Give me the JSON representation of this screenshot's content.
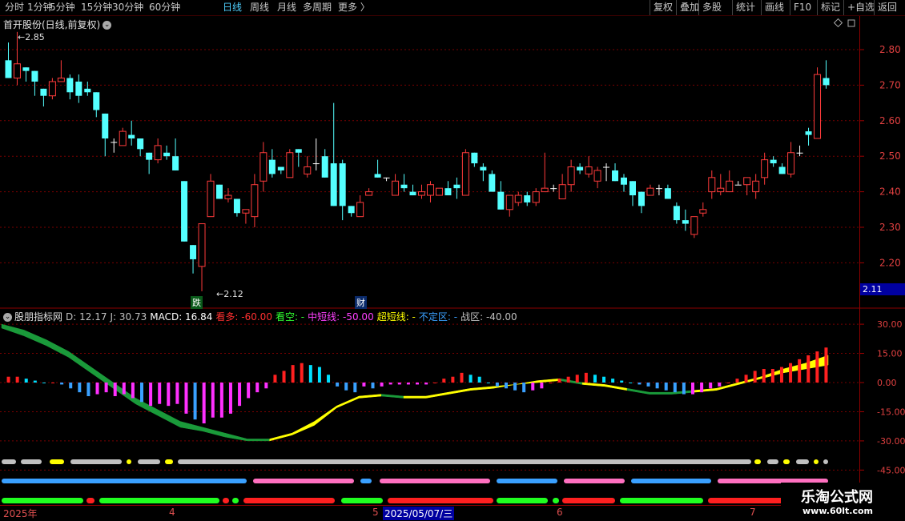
{
  "toolbar": {
    "periods": [
      "分时",
      "1分钟",
      "5分钟",
      "15分钟",
      "30分钟",
      "60分钟",
      "日线",
      "周线",
      "月线",
      "多周期",
      "更多 〉"
    ],
    "active_period": "日线",
    "right_items": [
      "复权",
      "叠加",
      "多股",
      "统计",
      "画线",
      "F10",
      "标记",
      "+自选",
      "返回"
    ]
  },
  "stock": {
    "title": "首开股份(日线,前复权)",
    "high_label": "2.85",
    "low_label": "2.12",
    "current_price": "2.11",
    "markers": [
      "跌",
      "财"
    ]
  },
  "price_axis": {
    "labels": [
      "2.80",
      "2.70",
      "2.60",
      "2.50",
      "2.40",
      "2.30",
      "2.20"
    ]
  },
  "indicator": {
    "name": "股朋指标网",
    "items": [
      {
        "label": "D: 12.17",
        "color": "#c0c0c0"
      },
      {
        "label": "J: 30.73",
        "color": "#c0c0c0"
      },
      {
        "label": "MACD: 16.84",
        "color": "#ffffff"
      },
      {
        "label": "看多: -60.00",
        "color": "#ff3030"
      },
      {
        "label": "看空: -",
        "color": "#30ff30"
      },
      {
        "label": "中短线: -50.00",
        "color": "#ff40ff"
      },
      {
        "label": "超短线: -",
        "color": "#ffff00"
      },
      {
        "label": "不定区: -",
        "color": "#3aa0ff"
      },
      {
        "label": "战区: -40.00",
        "color": "#c0c0c0"
      }
    ],
    "axis_labels": [
      "30.00",
      "15.00",
      "0.00",
      "-15.00",
      "-30.00",
      "-45.00"
    ]
  },
  "dates": {
    "items": [
      "2025年",
      "4",
      "5",
      "2025/05/07/三",
      "6",
      "7"
    ]
  },
  "watermark": {
    "line1": "乐淘公式网",
    "line2": "www.60lt.com"
  },
  "colors": {
    "up": "#ff3b3b",
    "down": "#54ffff",
    "grid": "#8b0000"
  },
  "chart_data": {
    "type": "candlestick",
    "price_range": [
      2.11,
      2.86
    ],
    "candles": [
      [
        2.77,
        2.72,
        2.82,
        2.72
      ],
      [
        2.72,
        2.76,
        2.85,
        2.7
      ],
      [
        2.75,
        2.74,
        2.75,
        2.71
      ],
      [
        2.74,
        2.71,
        2.74,
        2.67
      ],
      [
        2.69,
        2.67,
        2.69,
        2.64
      ],
      [
        2.67,
        2.71,
        2.72,
        2.66
      ],
      [
        2.71,
        2.72,
        2.77,
        2.71
      ],
      [
        2.72,
        2.68,
        2.73,
        2.66
      ],
      [
        2.71,
        2.67,
        2.73,
        2.65
      ],
      [
        2.69,
        2.68,
        2.71,
        2.67
      ],
      [
        2.68,
        2.63,
        2.68,
        2.61
      ],
      [
        2.62,
        2.55,
        2.62,
        2.5
      ],
      [
        2.54,
        2.54,
        2.55,
        2.51
      ],
      [
        2.53,
        2.57,
        2.58,
        2.53
      ],
      [
        2.56,
        2.55,
        2.6,
        2.53
      ],
      [
        2.55,
        2.52,
        2.55,
        2.5
      ],
      [
        2.51,
        2.49,
        2.51,
        2.45
      ],
      [
        2.49,
        2.53,
        2.55,
        2.48
      ],
      [
        2.51,
        2.5,
        2.53,
        2.49
      ],
      [
        2.5,
        2.46,
        2.55,
        2.46
      ],
      [
        2.43,
        2.26,
        2.43,
        2.26
      ],
      [
        2.25,
        2.21,
        2.25,
        2.17
      ],
      [
        2.19,
        2.31,
        2.31,
        2.12
      ],
      [
        2.33,
        2.43,
        2.45,
        2.33
      ],
      [
        2.42,
        2.38,
        2.42,
        2.38
      ],
      [
        2.38,
        2.39,
        2.41,
        2.37
      ],
      [
        2.38,
        2.34,
        2.38,
        2.33
      ],
      [
        2.34,
        2.35,
        2.35,
        2.31
      ],
      [
        2.33,
        2.42,
        2.45,
        2.3
      ],
      [
        2.43,
        2.51,
        2.54,
        2.4
      ],
      [
        2.49,
        2.45,
        2.52,
        2.44
      ],
      [
        2.47,
        2.46,
        2.47,
        2.45
      ],
      [
        2.44,
        2.51,
        2.52,
        2.44
      ],
      [
        2.52,
        2.51,
        2.52,
        2.47
      ],
      [
        2.45,
        2.47,
        2.5,
        2.44
      ],
      [
        2.48,
        2.48,
        2.55,
        2.46
      ],
      [
        2.5,
        2.44,
        2.52,
        2.44
      ],
      [
        2.48,
        2.36,
        2.65,
        2.36
      ],
      [
        2.48,
        2.36,
        2.49,
        2.32
      ],
      [
        2.36,
        2.34,
        2.36,
        2.33
      ],
      [
        2.33,
        2.37,
        2.39,
        2.34
      ],
      [
        2.39,
        2.4,
        2.41,
        2.4
      ],
      [
        2.45,
        2.44,
        2.49,
        2.44
      ],
      [
        2.44,
        2.44,
        2.44,
        2.43
      ],
      [
        2.39,
        2.43,
        2.45,
        2.39
      ],
      [
        2.42,
        2.41,
        2.45,
        2.4
      ],
      [
        2.4,
        2.39,
        2.42,
        2.39
      ],
      [
        2.39,
        2.4,
        2.42,
        2.38
      ],
      [
        2.39,
        2.42,
        2.43,
        2.37
      ],
      [
        2.39,
        2.41,
        2.41,
        2.39
      ],
      [
        2.41,
        2.39,
        2.43,
        2.39
      ],
      [
        2.42,
        2.41,
        2.44,
        2.38
      ],
      [
        2.39,
        2.51,
        2.52,
        2.4
      ],
      [
        2.51,
        2.48,
        2.51,
        2.47
      ],
      [
        2.47,
        2.46,
        2.48,
        2.43
      ],
      [
        2.45,
        2.4,
        2.46,
        2.4
      ],
      [
        2.4,
        2.35,
        2.43,
        2.35
      ],
      [
        2.35,
        2.39,
        2.39,
        2.33
      ],
      [
        2.37,
        2.39,
        2.4,
        2.36
      ],
      [
        2.39,
        2.37,
        2.4,
        2.36
      ],
      [
        2.37,
        2.4,
        2.41,
        2.36
      ],
      [
        2.4,
        2.41,
        2.51,
        2.4
      ],
      [
        2.41,
        2.41,
        2.42,
        2.4
      ],
      [
        2.38,
        2.42,
        2.45,
        2.38
      ],
      [
        2.42,
        2.47,
        2.49,
        2.4
      ],
      [
        2.47,
        2.46,
        2.48,
        2.45
      ],
      [
        2.45,
        2.47,
        2.5,
        2.44
      ],
      [
        2.43,
        2.46,
        2.47,
        2.41
      ],
      [
        2.47,
        2.47,
        2.48,
        2.43
      ],
      [
        2.46,
        2.43,
        2.48,
        2.43
      ],
      [
        2.44,
        2.42,
        2.45,
        2.4
      ],
      [
        2.43,
        2.39,
        2.43,
        2.36
      ],
      [
        2.4,
        2.36,
        2.4,
        2.34
      ],
      [
        2.39,
        2.41,
        2.42,
        2.39
      ],
      [
        2.41,
        2.41,
        2.42,
        2.39
      ],
      [
        2.41,
        2.38,
        2.42,
        2.38
      ],
      [
        2.36,
        2.32,
        2.37,
        2.31
      ],
      [
        2.32,
        2.31,
        2.35,
        2.29
      ],
      [
        2.28,
        2.33,
        2.33,
        2.27
      ],
      [
        2.34,
        2.35,
        2.37,
        2.33
      ],
      [
        2.4,
        2.44,
        2.46,
        2.38
      ],
      [
        2.4,
        2.41,
        2.45,
        2.39
      ],
      [
        2.4,
        2.43,
        2.46,
        2.4
      ],
      [
        2.42,
        2.42,
        2.43,
        2.42
      ],
      [
        2.42,
        2.44,
        2.44,
        2.39
      ],
      [
        2.4,
        2.43,
        2.45,
        2.38
      ],
      [
        2.44,
        2.49,
        2.51,
        2.42
      ],
      [
        2.49,
        2.48,
        2.5,
        2.47
      ],
      [
        2.47,
        2.45,
        2.48,
        2.45
      ],
      [
        2.45,
        2.51,
        2.54,
        2.44
      ],
      [
        2.51,
        2.51,
        2.53,
        2.5
      ],
      [
        2.57,
        2.56,
        2.58,
        2.53
      ],
      [
        2.55,
        2.73,
        2.75,
        2.55
      ],
      [
        2.72,
        2.7,
        2.77,
        2.69
      ]
    ],
    "macd": [
      3,
      3,
      2,
      1,
      0,
      0,
      -1,
      -3,
      -5,
      -7,
      -6,
      -5,
      -7,
      -6,
      -8,
      -10,
      -12,
      -11,
      -12,
      -11,
      -16,
      -19,
      -21,
      -18,
      -18,
      -16,
      -12,
      -8,
      -5,
      -3,
      4,
      6,
      9,
      10,
      9,
      8,
      4,
      -2,
      -4,
      -5,
      -2,
      -3,
      -2,
      -1,
      -1,
      -1,
      -1,
      -1,
      0,
      2,
      3,
      5,
      4,
      3,
      0,
      -2,
      -3,
      -4,
      -5,
      -4,
      -3,
      0,
      2,
      3,
      4,
      5,
      4,
      3,
      2,
      1,
      0,
      -1,
      -2,
      -3,
      -4,
      -5,
      -6,
      -6,
      -5,
      -3,
      -2,
      0,
      2,
      4,
      6,
      7,
      7,
      8,
      10,
      12,
      14,
      16,
      18
    ],
    "ribbon_upper": [
      30,
      27,
      22,
      16,
      8,
      0,
      -8,
      -14,
      -20,
      -23,
      -26,
      -29,
      -29,
      -26,
      -20,
      -12,
      -7,
      -6,
      -7,
      -7,
      -5,
      -3,
      -2,
      -1,
      1,
      2,
      0,
      -1,
      -3,
      -5,
      -5,
      -4,
      -3,
      0,
      3,
      7,
      10,
      14
    ],
    "ribbon_lower": [
      28,
      24,
      19,
      13,
      5,
      -3,
      -11,
      -17,
      -23,
      -25,
      -28,
      -30,
      -30,
      -27,
      -22,
      -13,
      -8,
      -7,
      -8,
      -8,
      -6,
      -4,
      -3,
      -1,
      0,
      1,
      -1,
      -2,
      -4,
      -6,
      -6,
      -5,
      -4,
      -1,
      2,
      5,
      7,
      9
    ],
    "ribbon_colors": [
      "#1a9a3a",
      "#1a9a3a",
      "#1a9a3a",
      "#1a9a3a",
      "#1a9a3a",
      "#1a9a3a",
      "#1a9a3a",
      "#1a9a3a",
      "#1a9a3a",
      "#1a9a3a",
      "#1a9a3a",
      "#1a9a3a",
      "#ffff00",
      "#ffff00",
      "#ffff00",
      "#ffff00",
      "#ffff00",
      "#1a9a3a",
      "#ffff00",
      "#ffff00",
      "#ffff00",
      "#ffff00",
      "#ffff00",
      "#ffff00",
      "#ffff00",
      "#1a9a3a",
      "#ffff00",
      "#ffff00",
      "#1a9a3a",
      "#1a9a3a",
      "#1a9a3a",
      "#ffff00",
      "#ffff00",
      "#ffff00",
      "#ffff00",
      "#ffff00",
      "#ffff00",
      "#ff3030"
    ],
    "bar_gray": [
      [
        2,
        20,
        "#c0c0c0"
      ],
      [
        26,
        52,
        "#c0c0c0"
      ],
      [
        62,
        80,
        "#ffff00"
      ],
      [
        88,
        152,
        "#c0c0c0"
      ],
      [
        158,
        164,
        "#ffff00"
      ],
      [
        172,
        200,
        "#c0c0c0"
      ],
      [
        206,
        216,
        "#ffff00"
      ],
      [
        222,
        938,
        "#c0c0c0"
      ],
      [
        942,
        950,
        "#ffff00"
      ],
      [
        958,
        972,
        "#c0c0c0"
      ],
      [
        978,
        986,
        "#ffff00"
      ],
      [
        994,
        1010,
        "#c0c0c0"
      ],
      [
        1016,
        1022,
        "#ffff00"
      ],
      [
        1028,
        1034,
        "#c0c0c0"
      ]
    ],
    "bar_blue": [
      [
        2,
        308,
        "#3aa0ff"
      ],
      [
        316,
        442,
        "#ff70c0"
      ],
      [
        450,
        464,
        "#3aa0ff"
      ],
      [
        474,
        612,
        "#ff70c0"
      ],
      [
        620,
        696,
        "#3aa0ff"
      ],
      [
        704,
        780,
        "#ff70c0"
      ],
      [
        788,
        888,
        "#3aa0ff"
      ],
      [
        896,
        1034,
        "#ff70c0"
      ]
    ],
    "bar_green": [
      [
        2,
        104,
        "#20ff20"
      ],
      [
        108,
        118,
        "#ff2020"
      ],
      [
        124,
        274,
        "#20ff20"
      ],
      [
        278,
        286,
        "#ff2020"
      ],
      [
        290,
        298,
        "#20ff20"
      ],
      [
        304,
        418,
        "#ff2020"
      ],
      [
        426,
        478,
        "#20ff20"
      ],
      [
        484,
        616,
        "#ff2020"
      ],
      [
        620,
        684,
        "#20ff20"
      ],
      [
        690,
        698,
        "#20ff20"
      ],
      [
        702,
        768,
        "#ff2020"
      ],
      [
        774,
        878,
        "#20ff20"
      ],
      [
        884,
        1034,
        "#ff2020"
      ]
    ]
  }
}
